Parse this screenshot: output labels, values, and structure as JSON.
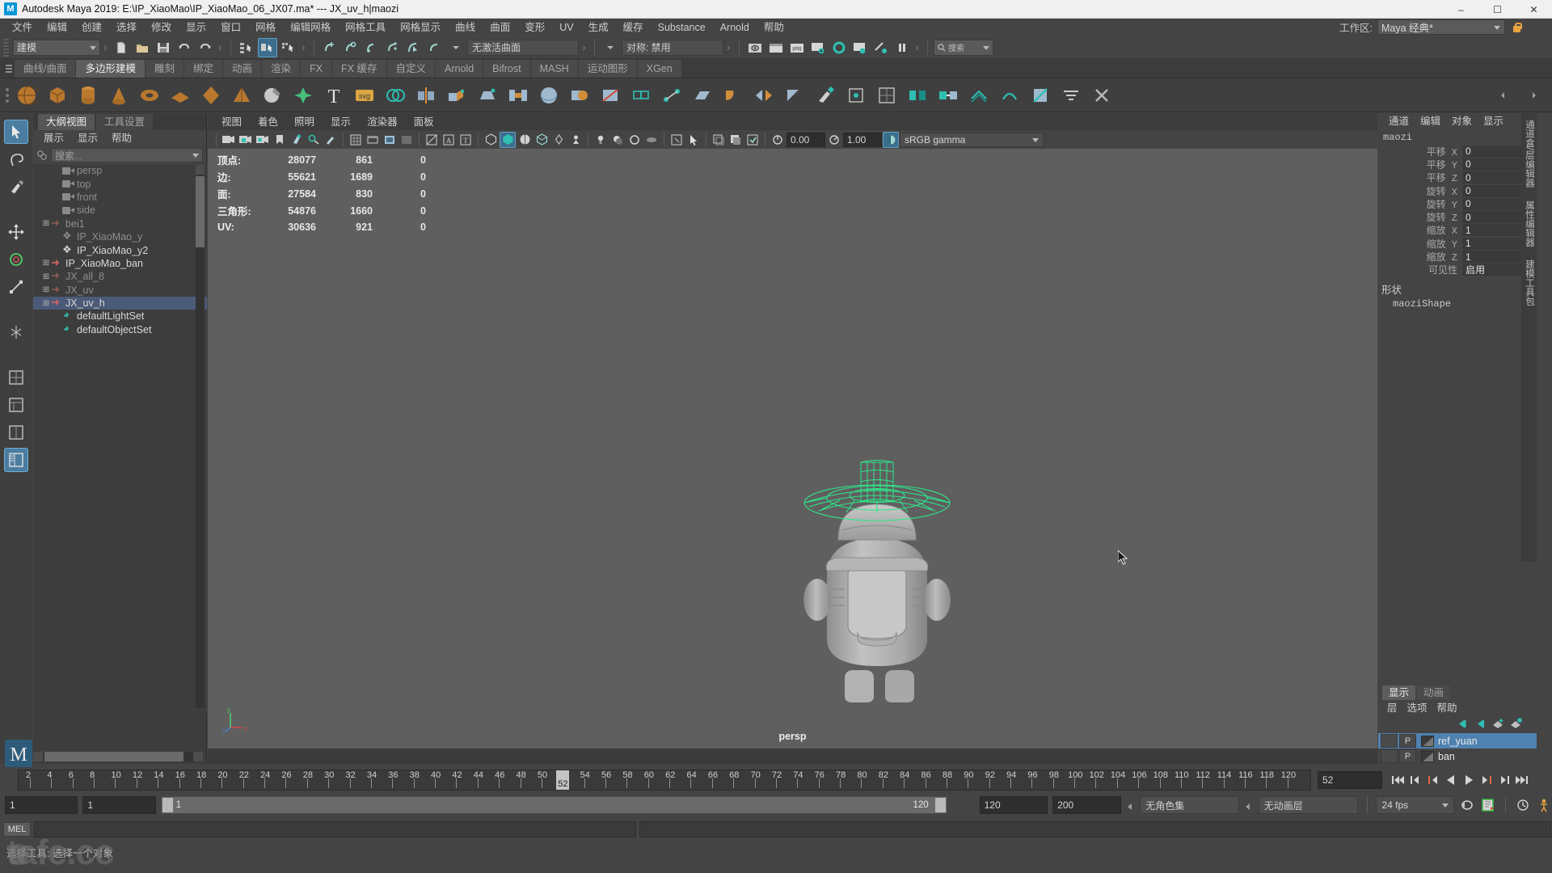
{
  "titlebar": {
    "app_title": "Autodesk Maya 2019: E:\\IP_XiaoMao\\IP_XiaoMao_06_JX07.ma*   ---   JX_uv_h|maozi",
    "logo": "M",
    "minimize": "–",
    "maximize": "☐",
    "close": "✕"
  },
  "menubar": {
    "items": [
      "文件",
      "编辑",
      "创建",
      "选择",
      "修改",
      "显示",
      "窗口",
      "网格",
      "编辑网格",
      "网格工具",
      "网格显示",
      "曲线",
      "曲面",
      "变形",
      "UV",
      "生成",
      "缓存",
      "Substance",
      "Arnold",
      "帮助"
    ],
    "workspace_label": "工作区:",
    "workspace_value": "Maya 经典*"
  },
  "statusline": {
    "mode_value": "建模",
    "snap_value": "无激活曲面",
    "symmetry_value": "对称: 禁用",
    "search_placeholder": "搜索"
  },
  "shelf": {
    "tabs": [
      "曲线/曲面",
      "多边形建模",
      "雕刻",
      "绑定",
      "动画",
      "渲染",
      "FX",
      "FX 缓存",
      "自定义",
      "Arnold",
      "Bifrost",
      "MASH",
      "运动图形",
      "XGen"
    ],
    "active_tab": "多边形建模"
  },
  "outliner": {
    "tabs": [
      "大纲视图",
      "工具设置"
    ],
    "active_tab": "大纲视图",
    "menus": [
      "展示",
      "显示",
      "帮助"
    ],
    "search_placeholder": "搜索...",
    "items": [
      {
        "label": "persp",
        "icon": "camera-icon",
        "indent": 1,
        "expandable": false,
        "dim": true,
        "selected": false
      },
      {
        "label": "top",
        "icon": "camera-icon",
        "indent": 1,
        "expandable": false,
        "dim": true,
        "selected": false
      },
      {
        "label": "front",
        "icon": "camera-icon",
        "indent": 1,
        "expandable": false,
        "dim": true,
        "selected": false
      },
      {
        "label": "side",
        "icon": "camera-icon",
        "indent": 1,
        "expandable": false,
        "dim": true,
        "selected": false
      },
      {
        "label": "bei1",
        "icon": "transform-icon",
        "indent": 0,
        "expandable": true,
        "dim": true,
        "selected": false
      },
      {
        "label": "IP_XiaoMao_y",
        "icon": "mesh-icon",
        "indent": 1,
        "expandable": false,
        "dim": true,
        "selected": false
      },
      {
        "label": "IP_XiaoMao_y2",
        "icon": "mesh-icon",
        "indent": 1,
        "expandable": false,
        "dim": false,
        "selected": false
      },
      {
        "label": "IP_XiaoMao_ban",
        "icon": "transform-icon",
        "indent": 0,
        "expandable": true,
        "dim": false,
        "selected": false
      },
      {
        "label": "JX_all_8",
        "icon": "transform-icon",
        "indent": 0,
        "expandable": true,
        "dim": true,
        "selected": false
      },
      {
        "label": "JX_uv",
        "icon": "transform-icon",
        "indent": 0,
        "expandable": true,
        "dim": true,
        "selected": false
      },
      {
        "label": "JX_uv_h",
        "icon": "transform-icon",
        "indent": 0,
        "expandable": true,
        "dim": false,
        "selected": true
      },
      {
        "label": "defaultLightSet",
        "icon": "set-icon",
        "indent": 1,
        "expandable": false,
        "dim": false,
        "selected": false
      },
      {
        "label": "defaultObjectSet",
        "icon": "set-icon",
        "indent": 1,
        "expandable": false,
        "dim": false,
        "selected": false
      }
    ]
  },
  "viewport": {
    "menus": [
      "视图",
      "着色",
      "照明",
      "显示",
      "渲染器",
      "面板"
    ],
    "exposure_value": "0.00",
    "gamma_value": "1.00",
    "color_profile": "sRGB gamma",
    "camera_label": "persp",
    "axis": {
      "x": "x",
      "y": "y",
      "z": "z"
    },
    "heads_up_display": {
      "rows": [
        {
          "label": "顶点:",
          "total": "28077",
          "selected": "861",
          "extra": "0"
        },
        {
          "label": "边:",
          "total": "55621",
          "selected": "1689",
          "extra": "0"
        },
        {
          "label": "面:",
          "total": "27584",
          "selected": "830",
          "extra": "0"
        },
        {
          "label": "三角形:",
          "total": "54876",
          "selected": "1660",
          "extra": "0"
        },
        {
          "label": "UV:",
          "total": "30636",
          "selected": "921",
          "extra": "0"
        }
      ]
    }
  },
  "channelbox": {
    "menus": [
      "通道",
      "编辑",
      "对象",
      "显示"
    ],
    "node_name": "maozi",
    "attributes": [
      {
        "name": "平移 X",
        "value": "0"
      },
      {
        "name": "平移 Y",
        "value": "0"
      },
      {
        "name": "平移 Z",
        "value": "0"
      },
      {
        "name": "旋转 X",
        "value": "0"
      },
      {
        "name": "旋转 Y",
        "value": "0"
      },
      {
        "name": "旋转 Z",
        "value": "0"
      },
      {
        "name": "缩放 X",
        "value": "1"
      },
      {
        "name": "缩放 Y",
        "value": "1"
      },
      {
        "name": "缩放 Z",
        "value": "1"
      },
      {
        "name": "可见性",
        "value": "启用"
      }
    ],
    "shape_header": "形状",
    "shape_name": "maoziShape",
    "side_tabs": [
      "通道盒/层编辑器",
      "属性编辑器",
      "建模工具包"
    ]
  },
  "layereditor": {
    "tabs": [
      "显示",
      "动画"
    ],
    "active_tab": "显示",
    "menus": [
      "层",
      "选项",
      "帮助"
    ],
    "layers": [
      {
        "name": "ref_yuan",
        "p": "P",
        "selected": true
      },
      {
        "name": "ban",
        "p": "P",
        "selected": false
      }
    ]
  },
  "timeslider": {
    "ticks": [
      "2",
      "4",
      "6",
      "8",
      "10",
      "12",
      "14",
      "16",
      "18",
      "20",
      "22",
      "24",
      "26",
      "28",
      "30",
      "32",
      "34",
      "36",
      "38",
      "40",
      "42",
      "44",
      "46",
      "48",
      "50",
      "52",
      "54",
      "56",
      "58",
      "60",
      "62",
      "64",
      "66",
      "68",
      "70",
      "72",
      "74",
      "76",
      "78",
      "80",
      "82",
      "84",
      "86",
      "88",
      "90",
      "92",
      "94",
      "96",
      "98",
      "100",
      "102",
      "104",
      "106",
      "108",
      "110",
      "112",
      "114",
      "116",
      "118",
      "120"
    ],
    "current_frame": "52",
    "current_frame_field": "52",
    "playback_buttons": [
      "go-to-start",
      "step-back-key",
      "step-back-frame",
      "play-backwards",
      "play-forwards",
      "step-forward-frame",
      "step-forward-key",
      "go-to-end"
    ]
  },
  "rangeslider": {
    "anim_start": "1",
    "range_start": "1",
    "slider_start_label": "1",
    "slider_end_label": "120",
    "range_end": "120",
    "anim_end": "200",
    "character_set": "无角色集",
    "anim_layer": "无动画层",
    "fps": "24 fps"
  },
  "commandline": {
    "language_tag": "MEL",
    "input_value": "",
    "output_value": ""
  },
  "helpline": {
    "message": "选择工具: 选择一个对象"
  },
  "watermark": {
    "text": "tafe.cc"
  },
  "colors": {
    "panel_bg": "#444444",
    "viewport_bg": "#5f5f5f",
    "accent_blue": "#4f82b0",
    "highlight_teal": "#3d6e8c",
    "selected_row": "#4a5a78",
    "wireframe_green": "#2ee68a",
    "model_gray": "#b4b4b4"
  }
}
